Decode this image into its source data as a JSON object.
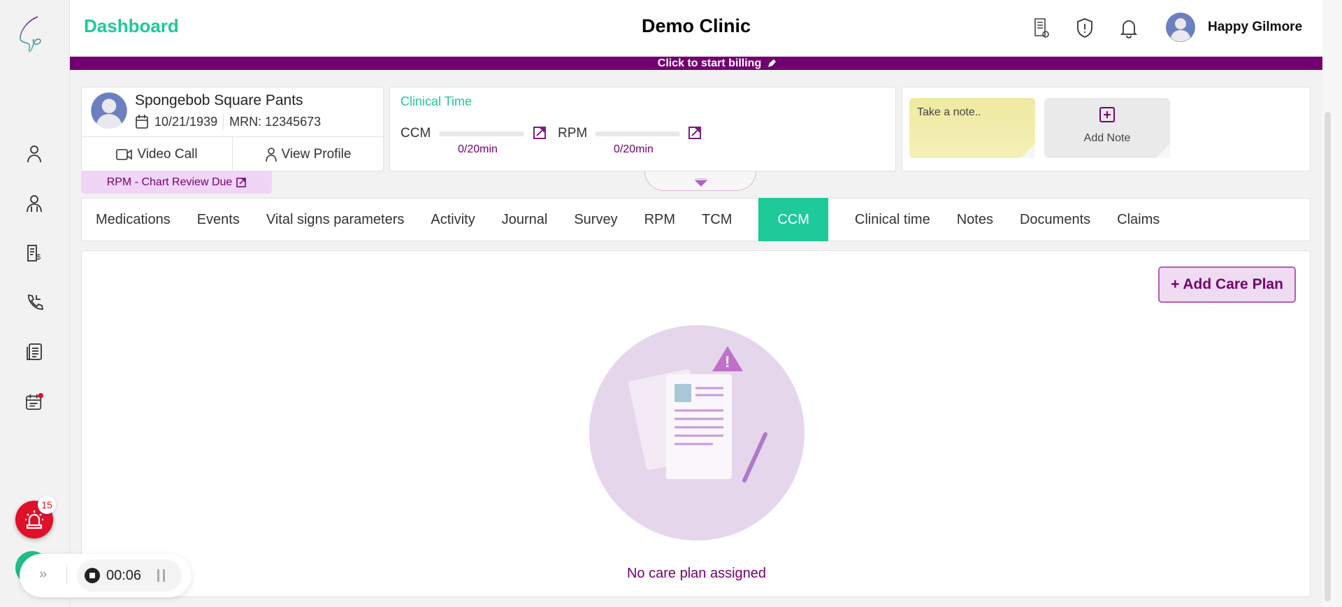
{
  "header": {
    "title": "Dashboard",
    "clinic": "Demo Clinic",
    "user_name": "Happy Gilmore"
  },
  "banner": {
    "text": "Click to start billing"
  },
  "patient": {
    "name": "Spongebob Square Pants",
    "dob": "10/21/1939",
    "mrn": "MRN: 12345673",
    "video_call": "Video Call",
    "view_profile": "View Profile",
    "alert_tag": "RPM - Chart Review Due"
  },
  "clinical_time": {
    "title": "Clinical Time",
    "items": [
      {
        "label": "CCM",
        "value": "0/20min",
        "progress": 0
      },
      {
        "label": "RPM",
        "value": "0/20min",
        "progress": 0
      }
    ]
  },
  "notes": {
    "placeholder": "Take a note..",
    "add_note": "Add Note"
  },
  "tabs": [
    "Medications",
    "Events",
    "Vital signs parameters",
    "Activity",
    "Journal",
    "Survey",
    "RPM",
    "TCM",
    "CCM",
    "Clinical time",
    "Notes",
    "Documents",
    "Claims"
  ],
  "active_tab": "CCM",
  "content": {
    "add_button": "+ Add Care Plan",
    "empty_text": "No care plan assigned"
  },
  "alarm": {
    "count": "15"
  },
  "timer": {
    "time": "00:06"
  },
  "colors": {
    "brand_purple": "#730070",
    "accent_green": "#1ec99a",
    "alarm_red": "#e0102a"
  }
}
